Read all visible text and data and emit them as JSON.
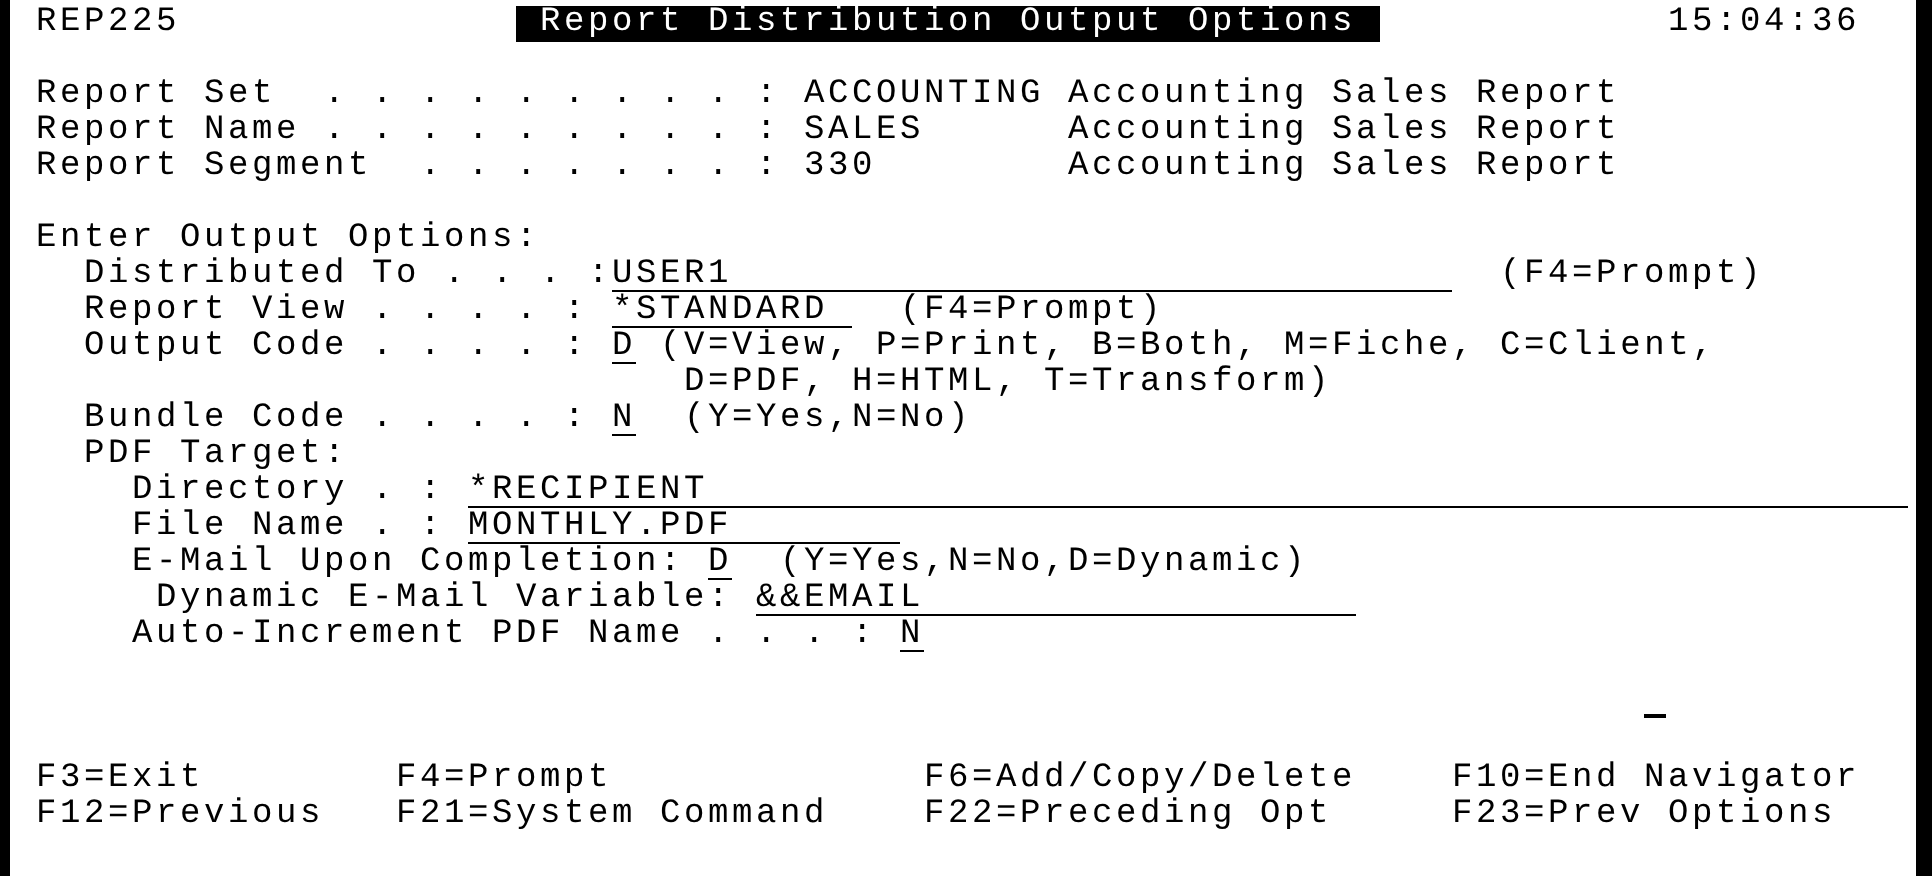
{
  "header": {
    "program": "REP225",
    "title": "Report Distribution Output Options",
    "time": "15:04:36"
  },
  "report_info": [
    {
      "label": "Report Set  . . . . . . . . . :",
      "value": "ACCOUNTING",
      "description": "Accounting Sales Report"
    },
    {
      "label": "Report Name . . . . . . . . . :",
      "value": "SALES",
      "description": "Accounting Sales Report"
    },
    {
      "label": "Report Segment  . . . . . . . :",
      "value": "330",
      "description": "Accounting Sales Report"
    }
  ],
  "section_title": "Enter Output Options:",
  "fields": [
    {
      "label": "Distributed To . . . :",
      "value": "USER1",
      "hint": [
        "(F4=Prompt)"
      ]
    },
    {
      "label": "Report View . . . . :",
      "value": "*STANDARD",
      "hint": [
        "(F4=Prompt)"
      ]
    },
    {
      "label": "Output Code . . . . :",
      "value": "D",
      "hint": [
        "(V=View, P=Print, B=Both, M=Fiche, C=Client,",
        "D=PDF, H=HTML, T=Transform)"
      ]
    },
    {
      "label": "Bundle Code . . . . :",
      "value": "N",
      "hint": [
        "(Y=Yes,N=No)"
      ]
    }
  ],
  "pdf_target": {
    "label": "PDF Target:",
    "fields": [
      {
        "label": "Directory . :",
        "value": "*RECIPIENT"
      },
      {
        "label": "File Name . :",
        "value": "MONTHLY.PDF"
      },
      {
        "label": "E-Mail Upon Completion:",
        "value": "D",
        "hint": [
          "(Y=Yes,N=No,D=Dynamic)"
        ]
      },
      {
        "label": "Dynamic E-Mail Variable:",
        "value": "&&EMAIL"
      },
      {
        "label": "Auto-Increment PDF Name . . . :",
        "value": "N"
      }
    ]
  },
  "function_keys": [
    "F3=Exit",
    "F4=Prompt",
    "F6=Add/Copy/Delete",
    "F10=End Navigator",
    "F12=Previous",
    "F21=System Command",
    "F22=Preceding Opt",
    "F23=Prev Options"
  ]
}
